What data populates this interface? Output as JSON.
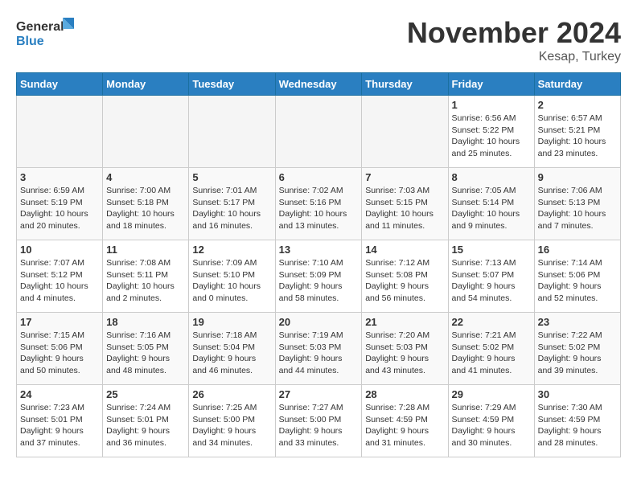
{
  "logo": {
    "line1": "General",
    "line2": "Blue"
  },
  "title": "November 2024",
  "location": "Kesap, Turkey",
  "weekdays": [
    "Sunday",
    "Monday",
    "Tuesday",
    "Wednesday",
    "Thursday",
    "Friday",
    "Saturday"
  ],
  "weeks": [
    [
      {
        "day": "",
        "info": ""
      },
      {
        "day": "",
        "info": ""
      },
      {
        "day": "",
        "info": ""
      },
      {
        "day": "",
        "info": ""
      },
      {
        "day": "",
        "info": ""
      },
      {
        "day": "1",
        "info": "Sunrise: 6:56 AM\nSunset: 5:22 PM\nDaylight: 10 hours and 25 minutes."
      },
      {
        "day": "2",
        "info": "Sunrise: 6:57 AM\nSunset: 5:21 PM\nDaylight: 10 hours and 23 minutes."
      }
    ],
    [
      {
        "day": "3",
        "info": "Sunrise: 6:59 AM\nSunset: 5:19 PM\nDaylight: 10 hours and 20 minutes."
      },
      {
        "day": "4",
        "info": "Sunrise: 7:00 AM\nSunset: 5:18 PM\nDaylight: 10 hours and 18 minutes."
      },
      {
        "day": "5",
        "info": "Sunrise: 7:01 AM\nSunset: 5:17 PM\nDaylight: 10 hours and 16 minutes."
      },
      {
        "day": "6",
        "info": "Sunrise: 7:02 AM\nSunset: 5:16 PM\nDaylight: 10 hours and 13 minutes."
      },
      {
        "day": "7",
        "info": "Sunrise: 7:03 AM\nSunset: 5:15 PM\nDaylight: 10 hours and 11 minutes."
      },
      {
        "day": "8",
        "info": "Sunrise: 7:05 AM\nSunset: 5:14 PM\nDaylight: 10 hours and 9 minutes."
      },
      {
        "day": "9",
        "info": "Sunrise: 7:06 AM\nSunset: 5:13 PM\nDaylight: 10 hours and 7 minutes."
      }
    ],
    [
      {
        "day": "10",
        "info": "Sunrise: 7:07 AM\nSunset: 5:12 PM\nDaylight: 10 hours and 4 minutes."
      },
      {
        "day": "11",
        "info": "Sunrise: 7:08 AM\nSunset: 5:11 PM\nDaylight: 10 hours and 2 minutes."
      },
      {
        "day": "12",
        "info": "Sunrise: 7:09 AM\nSunset: 5:10 PM\nDaylight: 10 hours and 0 minutes."
      },
      {
        "day": "13",
        "info": "Sunrise: 7:10 AM\nSunset: 5:09 PM\nDaylight: 9 hours and 58 minutes."
      },
      {
        "day": "14",
        "info": "Sunrise: 7:12 AM\nSunset: 5:08 PM\nDaylight: 9 hours and 56 minutes."
      },
      {
        "day": "15",
        "info": "Sunrise: 7:13 AM\nSunset: 5:07 PM\nDaylight: 9 hours and 54 minutes."
      },
      {
        "day": "16",
        "info": "Sunrise: 7:14 AM\nSunset: 5:06 PM\nDaylight: 9 hours and 52 minutes."
      }
    ],
    [
      {
        "day": "17",
        "info": "Sunrise: 7:15 AM\nSunset: 5:06 PM\nDaylight: 9 hours and 50 minutes."
      },
      {
        "day": "18",
        "info": "Sunrise: 7:16 AM\nSunset: 5:05 PM\nDaylight: 9 hours and 48 minutes."
      },
      {
        "day": "19",
        "info": "Sunrise: 7:18 AM\nSunset: 5:04 PM\nDaylight: 9 hours and 46 minutes."
      },
      {
        "day": "20",
        "info": "Sunrise: 7:19 AM\nSunset: 5:03 PM\nDaylight: 9 hours and 44 minutes."
      },
      {
        "day": "21",
        "info": "Sunrise: 7:20 AM\nSunset: 5:03 PM\nDaylight: 9 hours and 43 minutes."
      },
      {
        "day": "22",
        "info": "Sunrise: 7:21 AM\nSunset: 5:02 PM\nDaylight: 9 hours and 41 minutes."
      },
      {
        "day": "23",
        "info": "Sunrise: 7:22 AM\nSunset: 5:02 PM\nDaylight: 9 hours and 39 minutes."
      }
    ],
    [
      {
        "day": "24",
        "info": "Sunrise: 7:23 AM\nSunset: 5:01 PM\nDaylight: 9 hours and 37 minutes."
      },
      {
        "day": "25",
        "info": "Sunrise: 7:24 AM\nSunset: 5:01 PM\nDaylight: 9 hours and 36 minutes."
      },
      {
        "day": "26",
        "info": "Sunrise: 7:25 AM\nSunset: 5:00 PM\nDaylight: 9 hours and 34 minutes."
      },
      {
        "day": "27",
        "info": "Sunrise: 7:27 AM\nSunset: 5:00 PM\nDaylight: 9 hours and 33 minutes."
      },
      {
        "day": "28",
        "info": "Sunrise: 7:28 AM\nSunset: 4:59 PM\nDaylight: 9 hours and 31 minutes."
      },
      {
        "day": "29",
        "info": "Sunrise: 7:29 AM\nSunset: 4:59 PM\nDaylight: 9 hours and 30 minutes."
      },
      {
        "day": "30",
        "info": "Sunrise: 7:30 AM\nSunset: 4:59 PM\nDaylight: 9 hours and 28 minutes."
      }
    ]
  ]
}
